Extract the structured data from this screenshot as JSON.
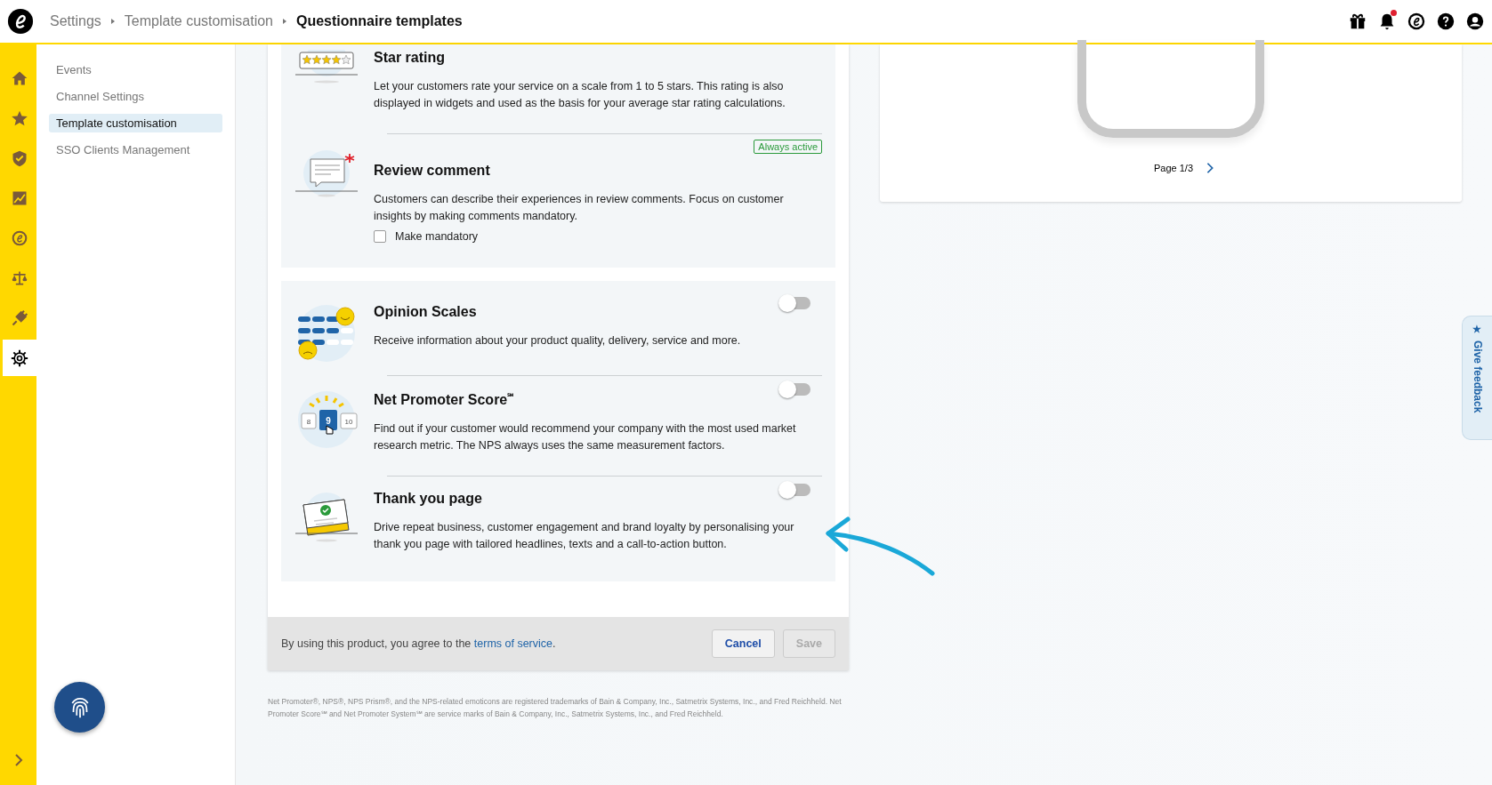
{
  "header": {
    "breadcrumbs": [
      {
        "label": "Settings"
      },
      {
        "label": "Template customisation"
      }
    ],
    "title": "Questionnaire templates",
    "has_notifications": true
  },
  "rail": {
    "items": [
      {
        "kind": "home",
        "selected": false
      },
      {
        "kind": "star",
        "selected": false
      },
      {
        "kind": "shield",
        "selected": false
      },
      {
        "kind": "chart",
        "selected": false
      },
      {
        "kind": "logo",
        "selected": false
      },
      {
        "kind": "scales",
        "selected": false
      },
      {
        "kind": "plug",
        "selected": false
      },
      {
        "kind": "gear",
        "selected": true
      }
    ]
  },
  "sidebar": {
    "items": [
      {
        "label": "Events",
        "selected": false
      },
      {
        "label": "Channel Settings",
        "selected": false
      },
      {
        "label": "Template customisation",
        "selected": true
      },
      {
        "label": "SSO Clients Management",
        "selected": false
      }
    ]
  },
  "groups": [
    {
      "kind": "required",
      "modules": [
        {
          "kind": "stars",
          "title": "Star rating",
          "description": "Let your customers rate your service on a scale from 1 to 5 stars. This rating is also displayed in widgets and used as the basis for your average star rating calculations."
        },
        {
          "kind": "comment",
          "title": "Review comment",
          "badge": "Always active",
          "description": "Customers can describe their experiences in review comments. Focus on customer insights by making comments mandatory.",
          "checkbox": {
            "label": "Make mandatory",
            "checked": false
          }
        }
      ]
    },
    {
      "kind": "optional",
      "modules": [
        {
          "kind": "opinion",
          "title": "Opinion Scales",
          "description": "Receive information about your product quality, delivery, service and more.",
          "toggle": {
            "on": false
          }
        },
        {
          "kind": "nps",
          "illustration_labels": [
            "8",
            "9",
            "10"
          ],
          "title": "Net Promoter Score$^{℠}$",
          "description": "Find out if your customer would recommend your company with the most used market research metric. The NPS always uses the same measurement factors.",
          "toggle": {
            "on": false
          }
        },
        {
          "kind": "thankyou",
          "title": "Thank you page",
          "description": "Drive repeat business, customer engagement and brand loyalty by personalising your thank you page with tailored headlines, texts and a call-to-action button.",
          "toggle": {
            "on": false
          }
        }
      ]
    }
  ],
  "footer": {
    "text": "By using this product, you agree to the ",
    "link": "terms of service",
    "after": ".",
    "buttons": [
      {
        "label": "Cancel",
        "disabled": false
      },
      {
        "label": "Save",
        "disabled": true
      }
    ]
  },
  "footnote": "Net Promoter®, NPS®, NPS Prism®, and the NPS-related emoticons are registered trademarks of Bain & Company, Inc., Satmetrix Systems, Inc., and Fred Reichheld. Net Promoter Score℠ and Net Promoter System℠ are service marks of Bain & Company, Inc., Satmetrix Systems, Inc., and Fred Reichheld.",
  "preview": {
    "page_label": "Page 1/3"
  },
  "feedback": {
    "icon": "★",
    "label": "Give feedback"
  }
}
